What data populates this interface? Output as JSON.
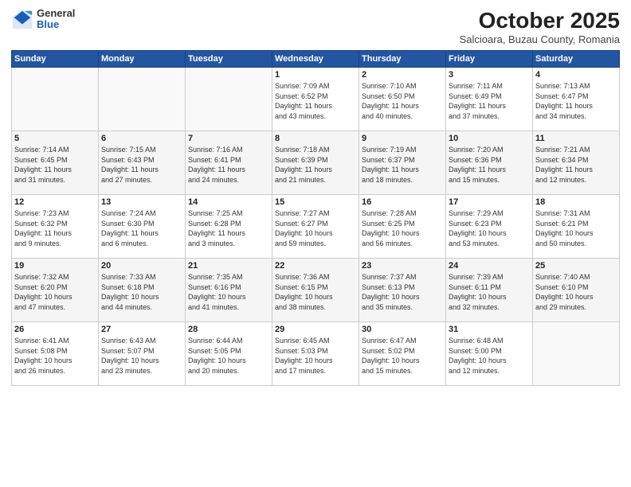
{
  "header": {
    "logo_general": "General",
    "logo_blue": "Blue",
    "month_title": "October 2025",
    "location": "Salcioara, Buzau County, Romania"
  },
  "days_of_week": [
    "Sunday",
    "Monday",
    "Tuesday",
    "Wednesday",
    "Thursday",
    "Friday",
    "Saturday"
  ],
  "weeks": [
    [
      {
        "day": "",
        "content": ""
      },
      {
        "day": "",
        "content": ""
      },
      {
        "day": "",
        "content": ""
      },
      {
        "day": "1",
        "content": "Sunrise: 7:09 AM\nSunset: 6:52 PM\nDaylight: 11 hours\nand 43 minutes."
      },
      {
        "day": "2",
        "content": "Sunrise: 7:10 AM\nSunset: 6:50 PM\nDaylight: 11 hours\nand 40 minutes."
      },
      {
        "day": "3",
        "content": "Sunrise: 7:11 AM\nSunset: 6:49 PM\nDaylight: 11 hours\nand 37 minutes."
      },
      {
        "day": "4",
        "content": "Sunrise: 7:13 AM\nSunset: 6:47 PM\nDaylight: 11 hours\nand 34 minutes."
      }
    ],
    [
      {
        "day": "5",
        "content": "Sunrise: 7:14 AM\nSunset: 6:45 PM\nDaylight: 11 hours\nand 31 minutes."
      },
      {
        "day": "6",
        "content": "Sunrise: 7:15 AM\nSunset: 6:43 PM\nDaylight: 11 hours\nand 27 minutes."
      },
      {
        "day": "7",
        "content": "Sunrise: 7:16 AM\nSunset: 6:41 PM\nDaylight: 11 hours\nand 24 minutes."
      },
      {
        "day": "8",
        "content": "Sunrise: 7:18 AM\nSunset: 6:39 PM\nDaylight: 11 hours\nand 21 minutes."
      },
      {
        "day": "9",
        "content": "Sunrise: 7:19 AM\nSunset: 6:37 PM\nDaylight: 11 hours\nand 18 minutes."
      },
      {
        "day": "10",
        "content": "Sunrise: 7:20 AM\nSunset: 6:36 PM\nDaylight: 11 hours\nand 15 minutes."
      },
      {
        "day": "11",
        "content": "Sunrise: 7:21 AM\nSunset: 6:34 PM\nDaylight: 11 hours\nand 12 minutes."
      }
    ],
    [
      {
        "day": "12",
        "content": "Sunrise: 7:23 AM\nSunset: 6:32 PM\nDaylight: 11 hours\nand 9 minutes."
      },
      {
        "day": "13",
        "content": "Sunrise: 7:24 AM\nSunset: 6:30 PM\nDaylight: 11 hours\nand 6 minutes."
      },
      {
        "day": "14",
        "content": "Sunrise: 7:25 AM\nSunset: 6:28 PM\nDaylight: 11 hours\nand 3 minutes."
      },
      {
        "day": "15",
        "content": "Sunrise: 7:27 AM\nSunset: 6:27 PM\nDaylight: 10 hours\nand 59 minutes."
      },
      {
        "day": "16",
        "content": "Sunrise: 7:28 AM\nSunset: 6:25 PM\nDaylight: 10 hours\nand 56 minutes."
      },
      {
        "day": "17",
        "content": "Sunrise: 7:29 AM\nSunset: 6:23 PM\nDaylight: 10 hours\nand 53 minutes."
      },
      {
        "day": "18",
        "content": "Sunrise: 7:31 AM\nSunset: 6:21 PM\nDaylight: 10 hours\nand 50 minutes."
      }
    ],
    [
      {
        "day": "19",
        "content": "Sunrise: 7:32 AM\nSunset: 6:20 PM\nDaylight: 10 hours\nand 47 minutes."
      },
      {
        "day": "20",
        "content": "Sunrise: 7:33 AM\nSunset: 6:18 PM\nDaylight: 10 hours\nand 44 minutes."
      },
      {
        "day": "21",
        "content": "Sunrise: 7:35 AM\nSunset: 6:16 PM\nDaylight: 10 hours\nand 41 minutes."
      },
      {
        "day": "22",
        "content": "Sunrise: 7:36 AM\nSunset: 6:15 PM\nDaylight: 10 hours\nand 38 minutes."
      },
      {
        "day": "23",
        "content": "Sunrise: 7:37 AM\nSunset: 6:13 PM\nDaylight: 10 hours\nand 35 minutes."
      },
      {
        "day": "24",
        "content": "Sunrise: 7:39 AM\nSunset: 6:11 PM\nDaylight: 10 hours\nand 32 minutes."
      },
      {
        "day": "25",
        "content": "Sunrise: 7:40 AM\nSunset: 6:10 PM\nDaylight: 10 hours\nand 29 minutes."
      }
    ],
    [
      {
        "day": "26",
        "content": "Sunrise: 6:41 AM\nSunset: 5:08 PM\nDaylight: 10 hours\nand 26 minutes."
      },
      {
        "day": "27",
        "content": "Sunrise: 6:43 AM\nSunset: 5:07 PM\nDaylight: 10 hours\nand 23 minutes."
      },
      {
        "day": "28",
        "content": "Sunrise: 6:44 AM\nSunset: 5:05 PM\nDaylight: 10 hours\nand 20 minutes."
      },
      {
        "day": "29",
        "content": "Sunrise: 6:45 AM\nSunset: 5:03 PM\nDaylight: 10 hours\nand 17 minutes."
      },
      {
        "day": "30",
        "content": "Sunrise: 6:47 AM\nSunset: 5:02 PM\nDaylight: 10 hours\nand 15 minutes."
      },
      {
        "day": "31",
        "content": "Sunrise: 6:48 AM\nSunset: 5:00 PM\nDaylight: 10 hours\nand 12 minutes."
      },
      {
        "day": "",
        "content": ""
      }
    ]
  ]
}
